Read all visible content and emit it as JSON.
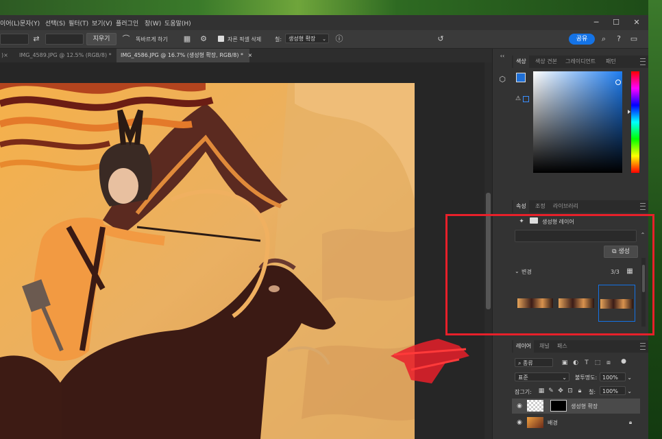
{
  "menu": [
    "이어(L)",
    "문자(Y)",
    "선택(S)",
    "필터(T)",
    "보기(V)",
    "플러그인",
    "창(W)",
    "도움말(H)"
  ],
  "options": {
    "erase_label": "지우기",
    "straighten_label": "똑바르게 하기",
    "delete_cropped_label": "자른 픽셀 삭제",
    "fill_label": "칠:",
    "fill_value": "생성형 확장",
    "share_label": "공유"
  },
  "tabs": [
    {
      "label": "IMG_4589.JPG @ 12.5% (RGB/8) *",
      "close": "×"
    },
    {
      "label": "IMG_4586.JPG @ 16.7% (생성형 확장, RGB/8) *",
      "close": "×"
    }
  ],
  "color_panel": {
    "tabs": [
      "색상",
      "색상 견본",
      "그레이디언트",
      "패턴"
    ],
    "foreground": "#1f6fd6",
    "background": "#ffffff",
    "picker_hue": "#1d7cf0"
  },
  "properties_panel": {
    "tabs": [
      "속성",
      "조정",
      "라이브러리"
    ],
    "layer_type": "생성형 레이어",
    "generate_label": "생성",
    "variations_label": "변경",
    "variations_count": "3/3"
  },
  "layers_panel": {
    "tabs": [
      "레이어",
      "채널",
      "패스"
    ],
    "filter_kind": "종류",
    "blend_mode": "표준",
    "opacity_label": "불투명도:",
    "opacity_value": "100%",
    "lock_label": "잠그기:",
    "fill_label": "칠:",
    "fill_value": "100%",
    "layers": [
      {
        "name": "생성형 확장"
      },
      {
        "name": "배경"
      }
    ]
  },
  "colors": {
    "accent": "#1473e6",
    "annotation_red": "#e8202a"
  }
}
